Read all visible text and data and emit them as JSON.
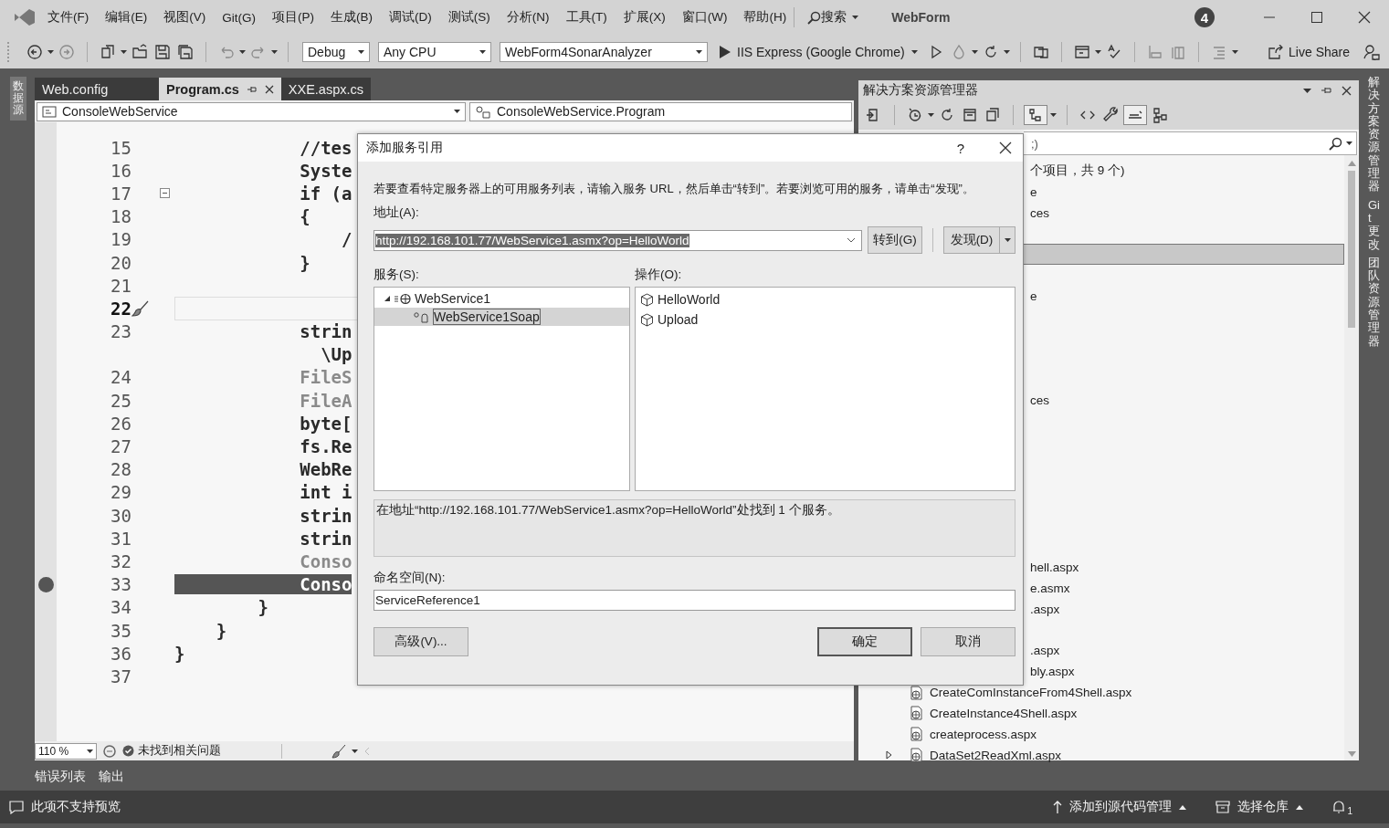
{
  "title_bar": {
    "menus": [
      "文件(F)",
      "编辑(E)",
      "视图(V)",
      "Git(G)",
      "项目(P)",
      "生成(B)",
      "调试(D)",
      "测试(S)",
      "分析(N)",
      "工具(T)",
      "扩展(X)",
      "窗口(W)",
      "帮助(H)"
    ],
    "search": "搜索",
    "solution_name": "WebForm",
    "notification_badge": "4"
  },
  "toolbar": {
    "configuration": "Debug",
    "platform": "Any CPU",
    "startup_project": "WebForm4SonarAnalyzer",
    "run_target": "IIS Express (Google Chrome)",
    "live_share": "Live Share"
  },
  "left_strip": {
    "label": "数据源"
  },
  "editor": {
    "tabs": [
      {
        "label": "Web.config",
        "selected": false
      },
      {
        "label": "Program.cs",
        "selected": true
      },
      {
        "label": "XXE.aspx.cs",
        "selected": false
      }
    ],
    "project_dropdown": "ConsoleWebService",
    "class_dropdown": "ConsoleWebService.Program",
    "lines": [
      {
        "number": "15",
        "text": "            //tes",
        "kind": "code"
      },
      {
        "number": "16",
        "text": "            Syste",
        "kind": "code"
      },
      {
        "number": "17",
        "text": "            if (a",
        "kind": "fold"
      },
      {
        "number": "18",
        "text": "            {",
        "kind": "code"
      },
      {
        "number": "19",
        "text": "                /",
        "kind": "code"
      },
      {
        "number": "20",
        "text": "            }",
        "kind": "code"
      },
      {
        "number": "21",
        "kind": "code"
      },
      {
        "number": "22",
        "kind": "current"
      },
      {
        "number": "23",
        "text": "            strin",
        "kind": "code"
      },
      {
        "text": "              \\Up",
        "kind": "code"
      },
      {
        "number": "24",
        "text": "            FileS",
        "kind": "dim"
      },
      {
        "number": "25",
        "text": "            FileA",
        "kind": "dim"
      },
      {
        "number": "26",
        "text": "            byte[",
        "kind": "code"
      },
      {
        "number": "27",
        "text": "            fs.Re",
        "kind": "code"
      },
      {
        "number": "28",
        "text": "            WebRe",
        "kind": "code"
      },
      {
        "number": "29",
        "text": "            int i",
        "kind": "code"
      },
      {
        "number": "30",
        "text": "            strin",
        "kind": "code"
      },
      {
        "number": "31",
        "text": "            strin",
        "kind": "code"
      },
      {
        "number": "32",
        "text": "            Conso",
        "kind": "dim"
      },
      {
        "number": "33",
        "text": "            Conso",
        "kind": "exec"
      },
      {
        "number": "34",
        "text": "        }",
        "kind": "code"
      },
      {
        "number": "35",
        "text": "    }",
        "kind": "code"
      },
      {
        "number": "36",
        "text": "}",
        "kind": "code"
      },
      {
        "number": "37",
        "kind": "code"
      }
    ],
    "zoom": "110 %",
    "issues": "未找到相关问题"
  },
  "solution_explorer": {
    "title": "解决方案资源管理器",
    "search_placeholder": ";)",
    "rows": [
      {
        "kind": "fragment",
        "text": "个项目，共 9 个)",
        "selected": false
      },
      {
        "kind": "fragment",
        "text": "e",
        "selected": false
      },
      {
        "kind": "fragment",
        "text": "ces",
        "selected": false
      },
      {
        "kind": "blank"
      },
      {
        "kind": "blank",
        "selected": true
      },
      {
        "kind": "blank"
      },
      {
        "kind": "fragment",
        "text": "e",
        "selected": false
      },
      {
        "kind": "blank"
      },
      {
        "kind": "blank"
      },
      {
        "kind": "blank"
      },
      {
        "kind": "blank"
      },
      {
        "kind": "fragment",
        "text": "ces",
        "selected": false
      },
      {
        "kind": "blank"
      },
      {
        "kind": "blank"
      },
      {
        "kind": "blank"
      },
      {
        "kind": "blank"
      },
      {
        "kind": "blank"
      },
      {
        "kind": "blank"
      },
      {
        "kind": "blank"
      },
      {
        "kind": "fragment",
        "text": "hell.aspx",
        "selected": false
      },
      {
        "kind": "fragment",
        "text": "e.asmx",
        "selected": false
      },
      {
        "kind": "fragment",
        "text": ".aspx",
        "selected": false
      },
      {
        "kind": "blank"
      },
      {
        "kind": "fragment",
        "text": ".aspx",
        "selected": false
      },
      {
        "kind": "fragment",
        "text": "bly.aspx",
        "selected": false
      },
      {
        "kind": "file",
        "text": "CreateComInstanceFrom4Shell.aspx",
        "selected": false
      },
      {
        "kind": "file",
        "text": "CreateInstance4Shell.aspx",
        "selected": false
      },
      {
        "kind": "file",
        "text": "createprocess.aspx",
        "selected": false
      },
      {
        "kind": "parent",
        "text": "DataSet2ReadXml.aspx",
        "selected": false
      }
    ]
  },
  "right_strip": [
    "解决方案资源管理器",
    "Git 更改",
    "团队资源管理器"
  ],
  "bottom_tabs": [
    "错误列表",
    "输出"
  ],
  "status_bar": {
    "message": "此项不支持预览",
    "source_control": "添加到源代码管理",
    "repository": "选择仓库",
    "notifications": "1"
  },
  "dialog": {
    "title": "添加服务引用",
    "help": "?",
    "instructions": "若要查看特定服务器上的可用服务列表，请输入服务 URL，然后单击“转到”。若要浏览可用的服务，请单击“发现”。",
    "address_label": "地址(A):",
    "address": "http://192.168.101.77/WebService1.asmx?op=HelloWorld",
    "address_selected": true,
    "go_button": "转到(G)",
    "discover_button": "发现(D)",
    "services_label": "服务(S):",
    "services": [
      {
        "label": "WebService1",
        "expanded": true,
        "selected": false,
        "children": [
          {
            "label": "WebService1Soap",
            "selected": true
          }
        ]
      }
    ],
    "operations_label": "操作(O):",
    "operations": [
      "HelloWorld",
      "Upload"
    ],
    "status": "在地址“http://192.168.101.77/WebService1.asmx?op=HelloWorld”处找到 1 个服务。",
    "namespace_label": "命名空间(N):",
    "namespace": "ServiceReference1",
    "advanced_button": "高级(V)...",
    "ok_button": "确定",
    "cancel_button": "取消"
  }
}
